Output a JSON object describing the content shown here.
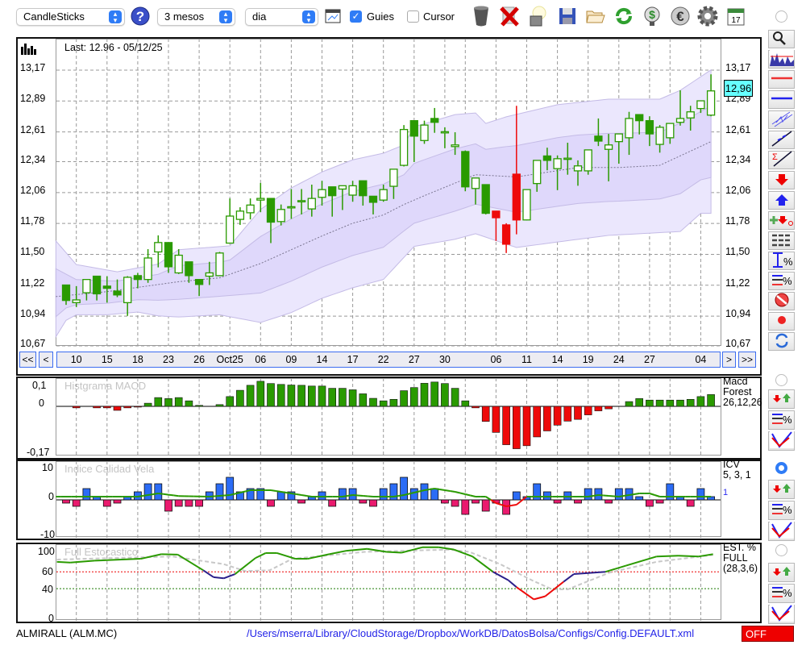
{
  "toolbar": {
    "chart_type": "CandleSticks",
    "period": "3 mesos",
    "interval": "dia",
    "guides_label": "Guies",
    "guides_checked": true,
    "cursor_label": "Cursor",
    "cursor_checked": false,
    "icons": [
      "help-icon",
      "chart-window-icon",
      "trash-icon",
      "delete-icon",
      "lamp-icon",
      "save-icon",
      "folder-icon",
      "refresh-icon",
      "recycle-dollar-icon",
      "euro-icon",
      "gear-icon",
      "calendar-icon"
    ],
    "calendar_day": "17"
  },
  "main": {
    "last_label": "Last: 12.96 - 05/12/25",
    "price_ticks": [
      "13,17",
      "12,89",
      "12,61",
      "12,34",
      "12,06",
      "11,78",
      "11,50",
      "11,22",
      "10,94",
      "10,67"
    ],
    "price_tick_values": [
      13.17,
      12.89,
      12.61,
      12.34,
      12.06,
      11.78,
      11.5,
      11.22,
      10.94,
      10.67
    ],
    "last_price_badge": "12,96",
    "nav": {
      "first": "<<",
      "prev": "<",
      "next": ">",
      "last": ">>"
    },
    "date_ticks": [
      {
        "i": 1,
        "label": "10"
      },
      {
        "i": 4,
        "label": "15"
      },
      {
        "i": 7,
        "label": "18"
      },
      {
        "i": 10,
        "label": "23"
      },
      {
        "i": 13,
        "label": "26"
      },
      {
        "i": 16,
        "label": "Oct25"
      },
      {
        "i": 19,
        "label": "06"
      },
      {
        "i": 22,
        "label": "09"
      },
      {
        "i": 25,
        "label": "14"
      },
      {
        "i": 28,
        "label": "17"
      },
      {
        "i": 31,
        "label": "22"
      },
      {
        "i": 34,
        "label": "27"
      },
      {
        "i": 37,
        "label": "30"
      },
      {
        "i": 39,
        "label": ""
      },
      {
        "i": 42,
        "label": "06"
      },
      {
        "i": 45,
        "label": "11"
      },
      {
        "i": 48,
        "label": "14"
      },
      {
        "i": 51,
        "label": "19"
      },
      {
        "i": 54,
        "label": "24"
      },
      {
        "i": 57,
        "label": "27"
      },
      {
        "i": 59,
        "label": ""
      },
      {
        "i": 62,
        "label": "04"
      }
    ]
  },
  "colors": {
    "up": "#2a9a00",
    "red": "#ee0a0a",
    "band_outer": "#ebe7fd",
    "band_inner": "#dcd5fa",
    "band_stroke": "#c4bbe6",
    "icv_pos": "#2b6cf6",
    "icv_neg": "#ea1a6e",
    "badge": "#66ffff",
    "stoch_mid": "#2b1f8a"
  },
  "chart_data": [
    {
      "type": "candlestick",
      "title": "ALMIRALL (ALM.MC)",
      "ylim": [
        10.67,
        13.17
      ],
      "ohlc": [
        [
          11.2,
          11.2,
          11.02,
          11.06
        ],
        [
          11.04,
          11.19,
          11.0,
          11.065
        ],
        [
          11.13,
          11.25,
          11.06,
          11.25
        ],
        [
          11.28,
          11.28,
          11.06,
          11.12
        ],
        [
          11.19,
          11.28,
          11.04,
          11.17
        ],
        [
          11.145,
          11.25,
          11.09,
          11.11
        ],
        [
          11.04,
          11.28,
          10.92,
          11.27
        ],
        [
          11.285,
          11.31,
          11.17,
          11.25
        ],
        [
          11.25,
          11.525,
          11.22,
          11.445
        ],
        [
          11.5,
          11.65,
          11.36,
          11.585
        ],
        [
          11.585,
          11.585,
          11.31,
          11.365
        ],
        [
          11.31,
          11.525,
          11.3,
          11.47
        ],
        [
          11.41,
          11.41,
          11.22,
          11.285
        ],
        [
          11.25,
          11.25,
          11.1,
          11.205
        ],
        [
          11.28,
          11.41,
          11.2,
          11.31
        ],
        [
          11.285,
          11.5,
          11.28,
          11.49
        ],
        [
          11.58,
          11.985,
          11.58,
          11.825
        ],
        [
          11.795,
          11.905,
          11.745,
          11.87
        ],
        [
          11.855,
          11.985,
          11.795,
          11.925
        ],
        [
          11.97,
          12.125,
          11.86,
          11.985
        ],
        [
          11.985,
          11.985,
          11.58,
          11.77
        ],
        [
          11.775,
          11.93,
          11.74,
          11.885
        ],
        [
          11.905,
          12.07,
          11.8,
          11.91
        ],
        [
          11.96,
          12.07,
          11.84,
          11.965
        ],
        [
          11.89,
          12.11,
          11.82,
          11.985
        ],
        [
          11.995,
          12.145,
          11.92,
          12.065
        ],
        [
          12.09,
          12.09,
          11.82,
          12.01
        ],
        [
          12.07,
          12.1,
          11.88,
          12.1
        ],
        [
          12.015,
          12.145,
          11.955,
          12.1
        ],
        [
          12.145,
          12.145,
          11.92,
          12.01
        ],
        [
          12.005,
          12.005,
          11.84,
          11.95
        ],
        [
          11.97,
          12.11,
          11.955,
          12.065
        ],
        [
          12.095,
          12.25,
          11.98,
          12.25
        ],
        [
          12.285,
          12.65,
          12.275,
          12.61
        ],
        [
          12.69,
          12.69,
          12.315,
          12.55
        ],
        [
          12.51,
          12.69,
          12.48,
          12.65
        ],
        [
          12.71,
          12.805,
          12.58,
          12.675
        ],
        [
          12.585,
          12.63,
          12.44,
          12.59
        ],
        [
          12.455,
          12.585,
          12.38,
          12.47
        ],
        [
          12.41,
          12.42,
          12.05,
          12.09
        ],
        [
          12.075,
          12.17,
          11.93,
          12.17
        ],
        [
          12.11,
          12.11,
          11.84,
          11.85
        ],
        [
          11.87,
          11.87,
          11.6,
          11.81
        ],
        [
          11.745,
          11.76,
          11.49,
          11.57
        ],
        [
          12.205,
          12.825,
          11.66,
          11.79
        ],
        [
          11.79,
          12.065,
          11.785,
          12.065
        ],
        [
          12.12,
          12.33,
          12.045,
          12.33
        ],
        [
          12.37,
          12.445,
          12.24,
          12.33
        ],
        [
          12.255,
          12.375,
          12.06,
          12.345
        ],
        [
          12.345,
          12.49,
          12.2,
          12.35
        ],
        [
          12.235,
          12.33,
          12.1,
          12.28
        ],
        [
          12.235,
          12.425,
          12.2,
          12.425
        ],
        [
          12.55,
          12.71,
          12.46,
          12.505
        ],
        [
          12.43,
          12.57,
          12.14,
          12.47
        ],
        [
          12.5,
          12.57,
          12.3,
          12.57
        ],
        [
          12.535,
          12.77,
          12.38,
          12.71
        ],
        [
          12.745,
          12.745,
          12.565,
          12.69
        ],
        [
          12.69,
          12.73,
          12.46,
          12.57
        ],
        [
          12.475,
          12.65,
          12.4,
          12.63
        ],
        [
          12.535,
          12.665,
          12.48,
          12.665
        ],
        [
          12.675,
          12.965,
          12.645,
          12.71
        ],
        [
          12.715,
          12.825,
          12.6,
          12.77
        ],
        [
          12.8,
          12.87,
          12.76,
          12.87
        ],
        [
          12.74,
          13.11,
          12.73,
          12.96
        ]
      ],
      "red_candles": [
        42,
        43,
        44
      ],
      "bands": {
        "upper": [
          [
            -1,
            11.6
          ],
          [
            1,
            11.385
          ],
          [
            5,
            11.32
          ],
          [
            9,
            11.39
          ],
          [
            11,
            11.52
          ],
          [
            16,
            11.555
          ],
          [
            19,
            11.885
          ],
          [
            22,
            12.08
          ],
          [
            25,
            12.225
          ],
          [
            28,
            12.335
          ],
          [
            31,
            12.395
          ],
          [
            33,
            12.47
          ],
          [
            34,
            12.635
          ],
          [
            38,
            12.745
          ],
          [
            40,
            12.76
          ],
          [
            41,
            12.665
          ],
          [
            43,
            12.725
          ],
          [
            48,
            12.835
          ],
          [
            53,
            12.885
          ],
          [
            58,
            12.885
          ],
          [
            60,
            12.965
          ],
          [
            63,
            13.15
          ]
        ],
        "middle": [
          [
            -1,
            11.095
          ],
          [
            4,
            11.14
          ],
          [
            11,
            11.23
          ],
          [
            15,
            11.265
          ],
          [
            19,
            11.395
          ],
          [
            22,
            11.52
          ],
          [
            25,
            11.645
          ],
          [
            28,
            11.76
          ],
          [
            31,
            11.835
          ],
          [
            33,
            11.93
          ],
          [
            35,
            12.01
          ],
          [
            40,
            12.2
          ],
          [
            44,
            12.18
          ],
          [
            50,
            12.265
          ],
          [
            54,
            12.265
          ],
          [
            58,
            12.285
          ],
          [
            63,
            12.5
          ]
        ],
        "lower": [
          [
            -1,
            10.73
          ],
          [
            0,
            10.88
          ],
          [
            1,
            10.93
          ],
          [
            4,
            10.93
          ],
          [
            7,
            10.955
          ],
          [
            9,
            10.92
          ],
          [
            11,
            10.91
          ],
          [
            15,
            10.93
          ],
          [
            19,
            10.86
          ],
          [
            22,
            10.95
          ],
          [
            25,
            11.08
          ],
          [
            28,
            11.175
          ],
          [
            31,
            11.25
          ],
          [
            33,
            11.45
          ],
          [
            34,
            11.55
          ],
          [
            38,
            11.615
          ],
          [
            40,
            11.665
          ],
          [
            44,
            11.54
          ],
          [
            48,
            11.59
          ],
          [
            53,
            11.65
          ],
          [
            60,
            11.685
          ],
          [
            62,
            11.85
          ],
          [
            63,
            11.85
          ]
        ]
      }
    },
    {
      "type": "bar",
      "title": "Histgrama MACD",
      "legend": [
        "Macd",
        "Forest",
        "26,12,26"
      ],
      "ylim": [
        -0.17,
        0.1
      ],
      "y_ticks": [
        "0,1",
        "0",
        "-0,17"
      ],
      "values": [
        0,
        -0.006,
        0,
        -0.006,
        -0.006,
        -0.016,
        -0.006,
        -0.003,
        0.0125,
        0.035,
        0.031,
        0.035,
        0.022,
        0.004,
        0,
        0.007,
        0.039,
        0.064,
        0.084,
        0.1,
        0.091,
        0.0875,
        0.085,
        0.084,
        0.081,
        0.081,
        0.072,
        0.072,
        0.066,
        0.05,
        0.032,
        0.022,
        0.028,
        0.0625,
        0.075,
        0.092,
        0.097,
        0.091,
        0.072,
        0.022,
        -0.006,
        -0.06,
        -0.104,
        -0.153,
        -0.169,
        -0.157,
        -0.122,
        -0.098,
        -0.075,
        -0.059,
        -0.052,
        -0.034,
        -0.018,
        -0.01,
        0,
        0.019,
        0.031,
        0.025,
        0.025,
        0.025,
        0.025,
        0.028,
        0.039,
        0.047
      ]
    },
    {
      "type": "bar",
      "title": "Indice Calidad Vela",
      "legend": [
        "ICV",
        "5, 3, 1",
        "1"
      ],
      "ylim": [
        -10,
        10
      ],
      "y_ticks": [
        "10",
        "0",
        "-10"
      ],
      "values": [
        -1,
        -2,
        3.5,
        1,
        -2,
        -1,
        1,
        2.5,
        5,
        5,
        -3.5,
        -2,
        -2,
        -2,
        2.5,
        5,
        7,
        2.5,
        3.5,
        3.5,
        -2,
        2.5,
        2.5,
        -1,
        1,
        2.5,
        -2,
        3.5,
        3.5,
        -1,
        -2,
        3.5,
        5,
        7,
        3.5,
        5,
        3.5,
        -1,
        -2,
        -4.5,
        -1,
        -3.5,
        -1,
        -4.5,
        2.5,
        1,
        5,
        2.5,
        -1,
        2.5,
        -1,
        3.5,
        3.5,
        -1,
        3.5,
        3.5,
        1,
        -2,
        -1,
        5,
        1,
        -2,
        3.5,
        1
      ],
      "signal": [
        [
          -1,
          1
        ],
        [
          7,
          1
        ],
        [
          9,
          2
        ],
        [
          11,
          1.2
        ],
        [
          14,
          1
        ],
        [
          16,
          1.5
        ],
        [
          18,
          3
        ],
        [
          20,
          3
        ],
        [
          22,
          2
        ],
        [
          24,
          1
        ],
        [
          27,
          1
        ],
        [
          28,
          1.5
        ],
        [
          30,
          1
        ],
        [
          32,
          1
        ],
        [
          33,
          1.5
        ],
        [
          35,
          3
        ],
        [
          36,
          3.5
        ],
        [
          38,
          2.5
        ],
        [
          40,
          1
        ],
        [
          41,
          1
        ],
        [
          42,
          -1
        ],
        [
          43,
          -2
        ],
        [
          44,
          -1.5
        ],
        [
          45,
          1
        ],
        [
          51,
          1
        ],
        [
          52,
          1.5
        ],
        [
          54,
          1
        ],
        [
          56,
          2
        ],
        [
          57,
          2
        ],
        [
          58,
          1
        ],
        [
          63,
          1
        ]
      ]
    },
    {
      "type": "line",
      "title": "Full Estocastico",
      "legend": [
        "EST. %",
        "FULL",
        "(28,3,6)"
      ],
      "ylim": [
        0,
        100
      ],
      "y_ticks": [
        "100",
        "60",
        "40",
        "0"
      ],
      "levels": [
        64,
        42
      ],
      "k": [
        [
          -0.9,
          77
        ],
        [
          0.4,
          76
        ],
        [
          2.8,
          78.5
        ],
        [
          7.3,
          81
        ],
        [
          9.3,
          87
        ],
        [
          10.9,
          86.5
        ],
        [
          13.4,
          66
        ],
        [
          14.4,
          57
        ],
        [
          15.4,
          55.5
        ],
        [
          16.5,
          61
        ],
        [
          18.5,
          82
        ],
        [
          19.5,
          88.5
        ],
        [
          20.6,
          88.5
        ],
        [
          22.4,
          81
        ],
        [
          23.6,
          81
        ],
        [
          25.7,
          87
        ],
        [
          27.4,
          91.5
        ],
        [
          29.4,
          94
        ],
        [
          31.3,
          90
        ],
        [
          32.8,
          89
        ],
        [
          34.8,
          96
        ],
        [
          36.4,
          96
        ],
        [
          37.9,
          93
        ],
        [
          39.7,
          84
        ],
        [
          41.7,
          64
        ],
        [
          43.2,
          53
        ],
        [
          44,
          44
        ],
        [
          45.7,
          28
        ],
        [
          46.8,
          32
        ],
        [
          48.6,
          51
        ],
        [
          49.6,
          61
        ],
        [
          52.7,
          64
        ],
        [
          54.7,
          72
        ],
        [
          57.7,
          84
        ],
        [
          59.8,
          85
        ],
        [
          61.8,
          84
        ],
        [
          63.2,
          87
        ]
      ],
      "d": [
        [
          -0.9,
          80
        ],
        [
          10.4,
          84
        ],
        [
          15.4,
          74
        ],
        [
          17.5,
          65
        ],
        [
          19.9,
          66
        ],
        [
          22.1,
          81
        ],
        [
          29.2,
          90
        ],
        [
          37.4,
          93
        ],
        [
          39.4,
          90
        ],
        [
          42.4,
          74
        ],
        [
          45.5,
          53
        ],
        [
          47.5,
          41
        ],
        [
          49,
          41
        ],
        [
          53.1,
          63
        ],
        [
          57.7,
          77
        ],
        [
          63.2,
          86
        ]
      ]
    }
  ],
  "status": {
    "symbol": "ALMIRALL (ALM.MC)",
    "config_path": "/Users/mserra/Library/CloudStorage/Dropbox/WorkDB/DatosBolsa/Configs/Config.DEFAULT.xml",
    "state": "OFF"
  },
  "sidebar": {
    "main_buttons": [
      "zoom-icon",
      "volume-profile-icon",
      "red-line-icon",
      "blue-line-icon",
      "channel-icon",
      "trendline-icon",
      "sum-trendline-icon",
      "sell-arrow-icon",
      "buy-arrow-icon",
      "add-signal-icon",
      "dashed-lines-icon",
      "range-percent-icon",
      "lines-percent-icon",
      "no-entry-icon",
      "record-icon",
      "sync-icon"
    ],
    "indicator_buttons": [
      "signals-icon",
      "lines-percent-icon",
      "cross-lines-icon"
    ]
  }
}
